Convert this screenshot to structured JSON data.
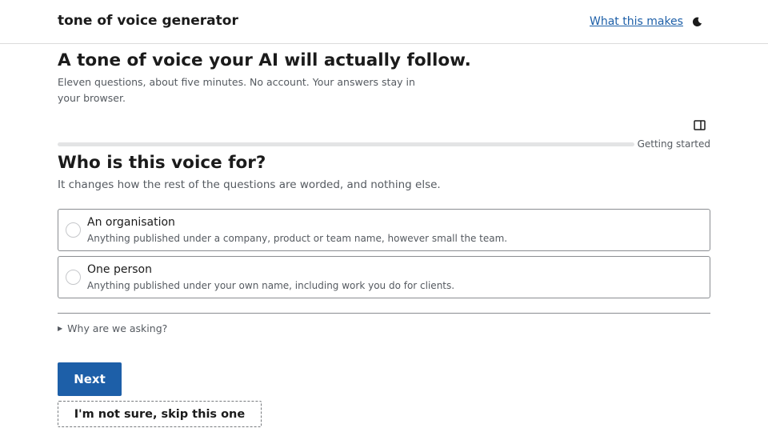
{
  "header": {
    "brand": "tone of voice generator",
    "link_label": "What this makes",
    "theme_icon": "moon-icon"
  },
  "hero": {
    "title": "A tone of voice your AI will actually follow.",
    "subtitle": "Eleven questions, about five minutes. No account. Your answers stay in your browser."
  },
  "progress": {
    "panel_icon": "sidebar-panel-icon",
    "label": "Getting started",
    "fraction": 0
  },
  "question": {
    "title": "Who is this voice for?",
    "subtitle": "It changes how the rest of the questions are worded, and nothing else.",
    "options": [
      {
        "label": "An organisation",
        "description": "Anything published under a company, product or team name, however small the team.",
        "selected": false
      },
      {
        "label": "One person",
        "description": "Anything published under your own name, including work you do for clients.",
        "selected": false
      }
    ],
    "disclosure": "Why are we asking?"
  },
  "actions": {
    "next_label": "Next",
    "skip_label": "I'm not sure, skip this one"
  },
  "colors": {
    "accent": "#1d5fa8",
    "text": "#1b1b1b",
    "muted": "#555a60"
  }
}
